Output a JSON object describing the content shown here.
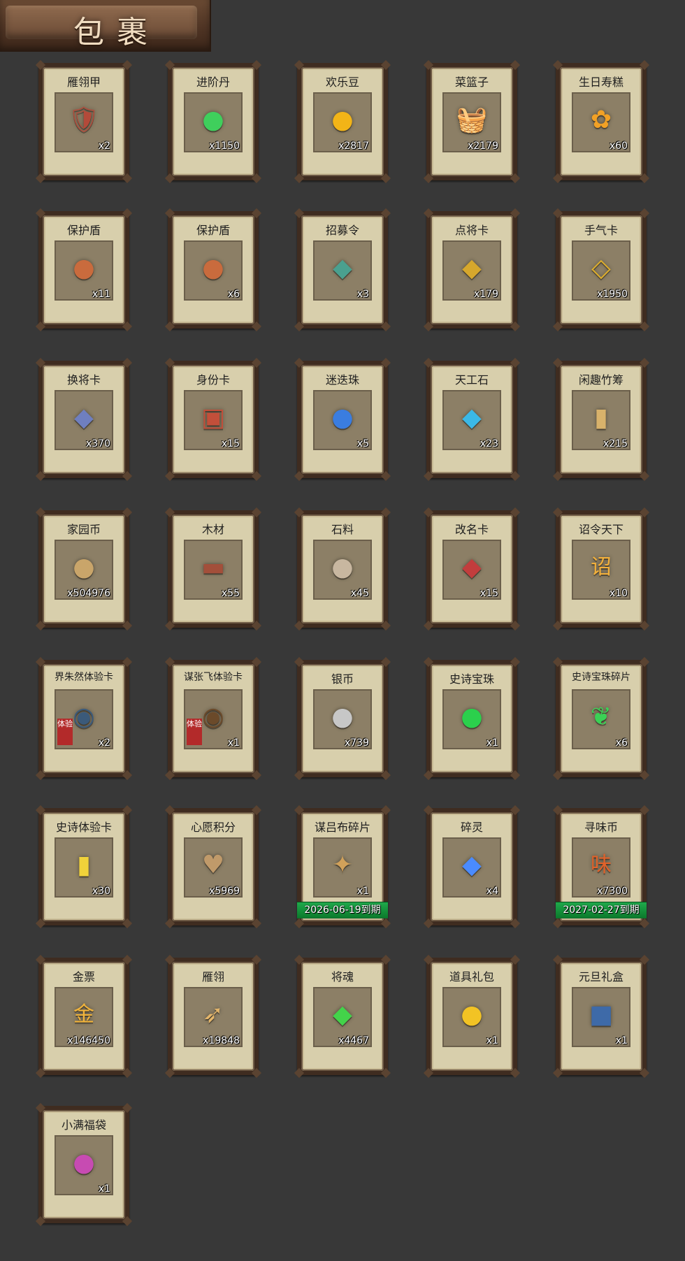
{
  "header": {
    "title": "包裹"
  },
  "items": [
    {
      "name": "雁翎甲",
      "qty": "x2",
      "icon": "armor-icon",
      "art": "🛡",
      "color": "#b34a3a"
    },
    {
      "name": "进阶丹",
      "qty": "x1150",
      "icon": "green-pill-icon",
      "art": "●",
      "color": "#3fcf5c"
    },
    {
      "name": "欢乐豆",
      "qty": "x2817",
      "icon": "gold-beans-icon",
      "art": "●",
      "color": "#f2b417"
    },
    {
      "name": "菜篮子",
      "qty": "x2179",
      "icon": "vegetable-basket-icon",
      "art": "🧺",
      "color": "#d98a2b"
    },
    {
      "name": "生日寿糕",
      "qty": "x60",
      "icon": "birthday-cake-icon",
      "art": "✿",
      "color": "#f2a125"
    },
    {
      "name": "保护盾",
      "qty": "x11",
      "icon": "shield-disc-icon",
      "art": "●",
      "color": "#c96b3d"
    },
    {
      "name": "保护盾",
      "qty": "x6",
      "icon": "shield-disc-icon",
      "art": "●",
      "color": "#c96b3d"
    },
    {
      "name": "招募令",
      "qty": "x3",
      "icon": "recruit-token-icon",
      "art": "◆",
      "color": "#4aa08f"
    },
    {
      "name": "点将卡",
      "qty": "x179",
      "icon": "general-card-icon",
      "art": "◆",
      "color": "#d6a72c"
    },
    {
      "name": "手气卡",
      "qty": "x1950",
      "icon": "luck-card-icon",
      "art": "◇",
      "color": "#e0b02b"
    },
    {
      "name": "换将卡",
      "qty": "x370",
      "icon": "swap-general-card-icon",
      "art": "◆",
      "color": "#6f7fbf"
    },
    {
      "name": "身份卡",
      "qty": "x15",
      "icon": "identity-card-icon",
      "art": "▣",
      "color": "#c24f3a"
    },
    {
      "name": "迷迭珠",
      "qty": "x5",
      "icon": "blue-orb-icon",
      "art": "●",
      "color": "#3a7de0"
    },
    {
      "name": "天工石",
      "qty": "x23",
      "icon": "crystal-icon",
      "art": "◆",
      "color": "#3bb8e6"
    },
    {
      "name": "闲趣竹筹",
      "qty": "x215",
      "icon": "bamboo-tally-icon",
      "art": "▮",
      "color": "#d8b26b"
    },
    {
      "name": "家园币",
      "qty": "x504976",
      "icon": "home-coin-icon",
      "art": "●",
      "color": "#c9a56a"
    },
    {
      "name": "木材",
      "qty": "x55",
      "icon": "wood-icon",
      "art": "▬",
      "color": "#a34f3a"
    },
    {
      "name": "石料",
      "qty": "x45",
      "icon": "stone-icon",
      "art": "●",
      "color": "#c8b7a0"
    },
    {
      "name": "改名卡",
      "qty": "x15",
      "icon": "rename-card-icon",
      "art": "◆",
      "color": "#c23d3d"
    },
    {
      "name": "诏令天下",
      "qty": "x10",
      "icon": "edict-scroll-icon",
      "art": "诏",
      "color": "#f2b03b"
    },
    {
      "name": "界朱然体验卡",
      "qty": "x2",
      "icon": "hero-portrait-icon",
      "art": "◉",
      "color": "#3b5a7a",
      "badge": "体验"
    },
    {
      "name": "谋张飞体验卡",
      "qty": "x1",
      "icon": "hero-portrait-icon",
      "art": "◉",
      "color": "#6b4a2a",
      "badge": "体验"
    },
    {
      "name": "银币",
      "qty": "x739",
      "icon": "silver-coin-icon",
      "art": "●",
      "color": "#c7c7c7"
    },
    {
      "name": "史诗宝珠",
      "qty": "x1",
      "icon": "epic-orb-icon",
      "art": "●",
      "color": "#2bd04c"
    },
    {
      "name": "史诗宝珠碎片",
      "qty": "x6",
      "icon": "epic-orb-shard-icon",
      "art": "❦",
      "color": "#3ad155"
    },
    {
      "name": "史诗体验卡",
      "qty": "x30",
      "icon": "epic-trial-card-icon",
      "art": "▮",
      "color": "#f0d23a"
    },
    {
      "name": "心愿积分",
      "qty": "x5969",
      "icon": "wish-points-icon",
      "art": "♥",
      "color": "#c09a6a"
    },
    {
      "name": "谋吕布碎片",
      "qty": "x1",
      "icon": "hero-shard-icon",
      "art": "✦",
      "color": "#d1a15a",
      "expiry": "2026-06-19到期"
    },
    {
      "name": "碎灵",
      "qty": "x4",
      "icon": "spirit-crystal-icon",
      "art": "◆",
      "color": "#4a8bff"
    },
    {
      "name": "寻味币",
      "qty": "x7300",
      "icon": "flavor-coin-icon",
      "art": "味",
      "color": "#e0622a",
      "expiry": "2027-02-27到期"
    },
    {
      "name": "金票",
      "qty": "x146450",
      "icon": "gold-ticket-icon",
      "art": "金",
      "color": "#f2b43a"
    },
    {
      "name": "雁翎",
      "qty": "x19848",
      "icon": "feather-icon",
      "art": "➶",
      "color": "#e3b56a"
    },
    {
      "name": "将魂",
      "qty": "x4467",
      "icon": "general-soul-icon",
      "art": "◆",
      "color": "#43d34a"
    },
    {
      "name": "道具礼包",
      "qty": "x1",
      "icon": "gift-bag-icon",
      "art": "●",
      "color": "#f2c324"
    },
    {
      "name": "元旦礼盒",
      "qty": "x1",
      "icon": "gift-box-icon",
      "art": "■",
      "color": "#3e6aa8"
    },
    {
      "name": "小满福袋",
      "qty": "x1",
      "icon": "lucky-bag-icon",
      "art": "●",
      "color": "#c74bb2"
    }
  ]
}
